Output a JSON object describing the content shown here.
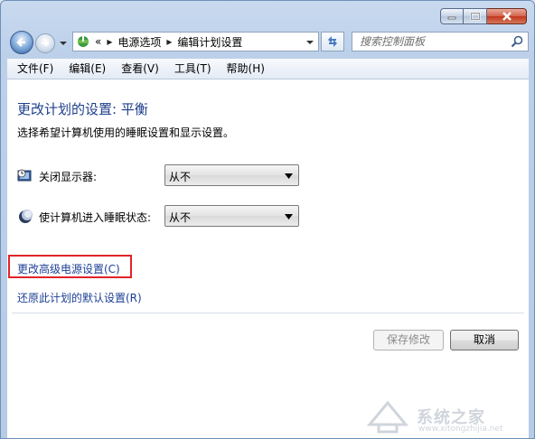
{
  "window": {
    "controls": {
      "minimize_icon": "minimize-icon",
      "maximize_icon": "maximize-icon",
      "close_icon": "close-icon"
    }
  },
  "address_bar": {
    "prefix": "«",
    "breadcrumbs": [
      "电源选项",
      "编辑计划设置"
    ],
    "separator": "▸"
  },
  "search": {
    "placeholder": "搜索控制面板"
  },
  "menu": [
    {
      "label": "文件(F)"
    },
    {
      "label": "编辑(E)"
    },
    {
      "label": "查看(V)"
    },
    {
      "label": "工具(T)"
    },
    {
      "label": "帮助(H)"
    }
  ],
  "main": {
    "title": "更改计划的设置: 平衡",
    "subtitle": "选择希望计算机使用的睡眠设置和显示设置。",
    "settings": [
      {
        "label": "关闭显示器:",
        "value": "从不",
        "icon": "monitor-clock-icon"
      },
      {
        "label": "使计算机进入睡眠状态:",
        "value": "从不",
        "icon": "moon-sleep-icon"
      }
    ],
    "links": {
      "advanced": "更改高级电源设置(C)",
      "restore": "还原此计划的默认设置(R)"
    },
    "buttons": {
      "save": "保存修改",
      "cancel": "取消"
    }
  },
  "watermark": {
    "text": "系统之家",
    "url": "www.xitongzhijia.net"
  },
  "colors": {
    "title": "#1e3f8b",
    "link": "#1c3f95",
    "highlight": "#e0242a"
  }
}
